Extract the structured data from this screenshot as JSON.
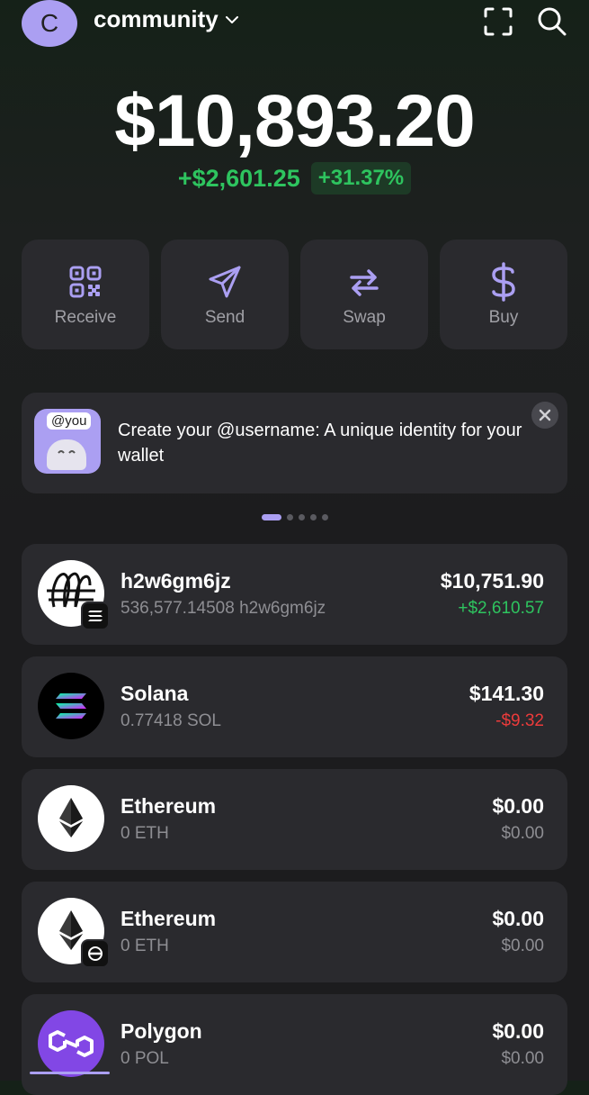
{
  "header": {
    "avatar_letter": "C",
    "account_name": "community",
    "icons": [
      "chevron-down-icon",
      "scan-icon",
      "search-icon"
    ]
  },
  "balance": {
    "total": "$10,893.20",
    "change_amount": "+$2,601.25",
    "change_percent": "+31.37%"
  },
  "actions": [
    {
      "label": "Receive",
      "icon": "qr-code-icon"
    },
    {
      "label": "Send",
      "icon": "send-icon"
    },
    {
      "label": "Swap",
      "icon": "swap-icon"
    },
    {
      "label": "Buy",
      "icon": "dollar-icon"
    }
  ],
  "banner": {
    "tag": "@you",
    "text": "Create your @username: A unique identity for your wallet",
    "page_count": 5,
    "active_page": 1
  },
  "tokens": [
    {
      "name": "h2w6gm6jz",
      "amount": "536,577.14508 h2w6gm6jz",
      "value": "$10,751.90",
      "change": "+$2,610.57",
      "trend": "up"
    },
    {
      "name": "Solana",
      "amount": "0.77418 SOL",
      "value": "$141.30",
      "change": "-$9.32",
      "trend": "down"
    },
    {
      "name": "Ethereum",
      "amount": "0 ETH",
      "value": "$0.00",
      "change": "$0.00",
      "trend": "flat"
    },
    {
      "name": "Ethereum",
      "amount": "0 ETH",
      "value": "$0.00",
      "change": "$0.00",
      "trend": "flat"
    },
    {
      "name": "Polygon",
      "amount": "0 POL",
      "value": "$0.00",
      "change": "$0.00",
      "trend": "flat"
    }
  ],
  "colors": {
    "accent": "#ab9ff2",
    "positive": "#2ec45f",
    "negative": "#ec3b3b",
    "card": "#2a2a2e"
  }
}
